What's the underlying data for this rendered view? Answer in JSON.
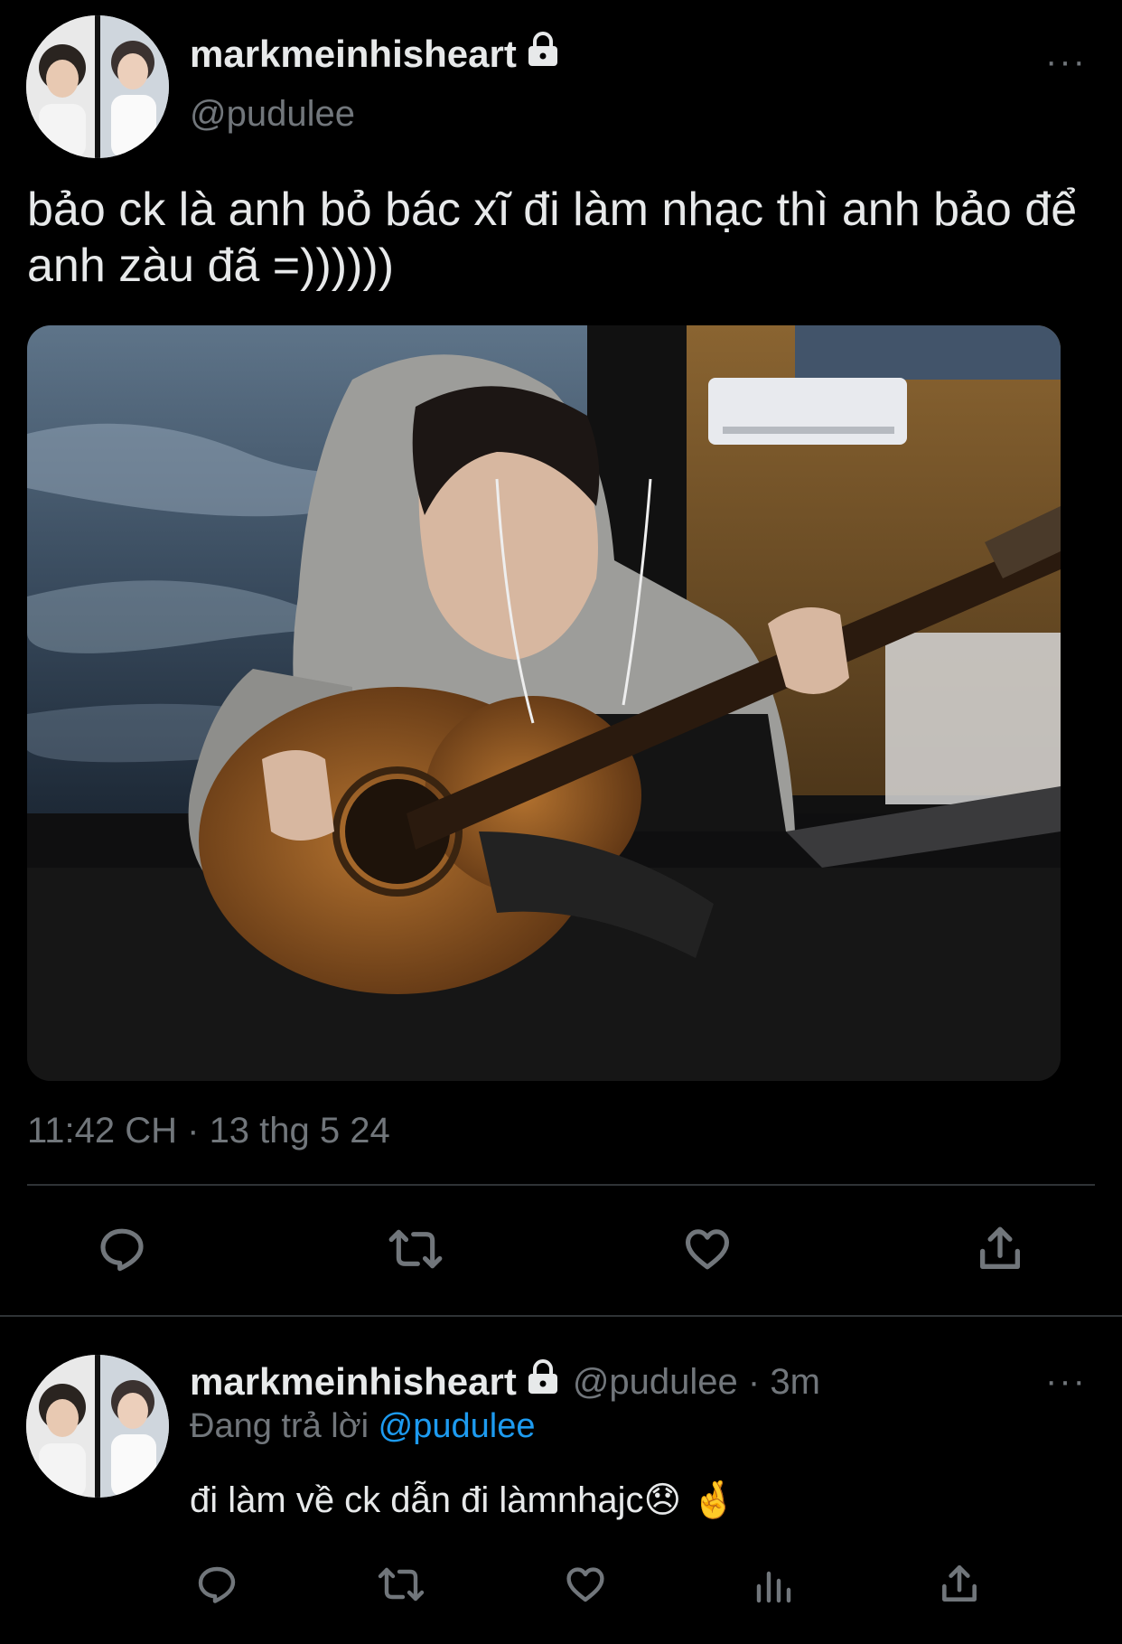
{
  "main_tweet": {
    "display_name": "markmeinhisheart",
    "handle": "@pudulee",
    "text": "bảo ck là anh bỏ bác xĩ đi làm nhạc thì anh bảo để anh zàu đã =))))))",
    "timestamp": "11:42 CH · 13 thg 5 24",
    "more_label": "···"
  },
  "reply": {
    "display_name": "markmeinhisheart",
    "handle_time": "@pudulee · 3m",
    "replying_prefix": "Đang trả lời",
    "replying_to": "@pudulee",
    "text": "đi làm về ck dẫn đi làmnhajc😞 🤞",
    "more_label": "···"
  },
  "icons": [
    "lock-icon",
    "reply-icon",
    "retweet-icon",
    "like-icon",
    "share-icon",
    "views-icon",
    "more-icon"
  ],
  "colors": {
    "background": "#000000",
    "text": "#e7e9ea",
    "muted": "#71767b",
    "link": "#1d9bf0",
    "divider": "#2f3336"
  }
}
